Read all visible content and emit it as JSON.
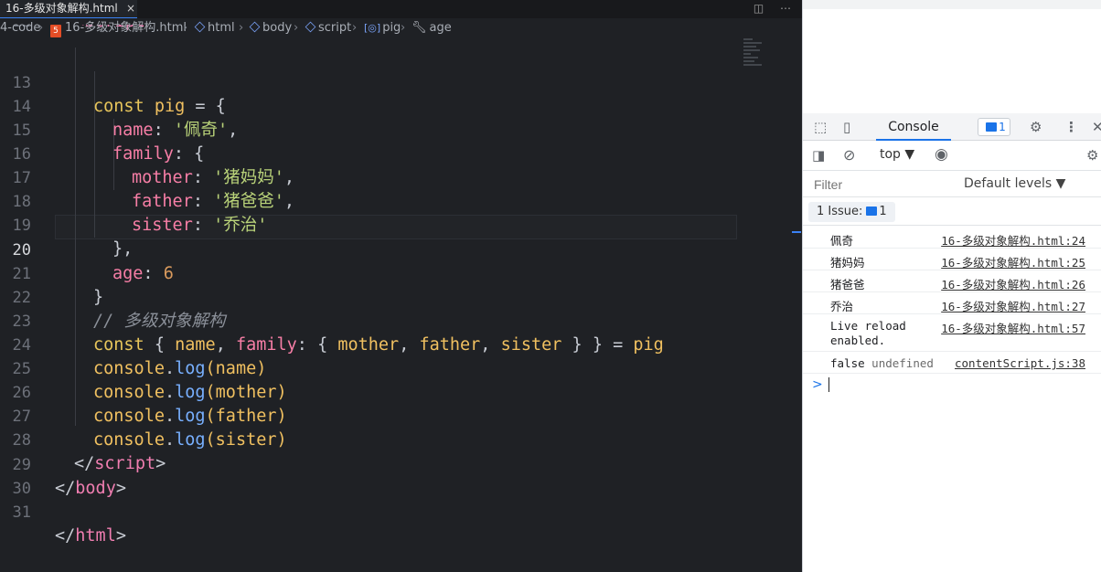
{
  "editor": {
    "tab_title": "16-多级对象解构.html",
    "tab_close": "×",
    "breadcrumb": {
      "folder": "4-code",
      "file": "16-多级对象解构.html",
      "html": "html",
      "body": "body",
      "script": "script",
      "pig": "pig",
      "age": "age"
    },
    "current_line": "20",
    "line_numbers": [
      "13",
      "14",
      "15",
      "16",
      "17",
      "18",
      "19",
      "20",
      "21",
      "22",
      "23",
      "24",
      "25",
      "26",
      "27",
      "28",
      "29",
      "30",
      "31"
    ],
    "code": {
      "l13_const": "const",
      "l13_var": "pig",
      "l13_rest": " = {",
      "l14_prop": "name",
      "l14_colon": ": ",
      "l14_str": "'佩奇'",
      "l14_comma": ",",
      "l15_prop": "family",
      "l15_rest": ": {",
      "l16_prop": "mother",
      "l16_colon": ": ",
      "l16_str": "'猪妈妈'",
      "l16_comma": ",",
      "l17_prop": "father",
      "l17_colon": ": ",
      "l17_str": "'猪爸爸'",
      "l17_comma": ",",
      "l18_prop": "sister",
      "l18_colon": ": ",
      "l18_str": "'乔治'",
      "l19": "},",
      "l20_prop": "age",
      "l20_colon": ": ",
      "l20_num": "6",
      "l21": "}",
      "l22": "// 多级对象解构",
      "l23_const": "const",
      "l23_a": " { ",
      "l23_name": "name",
      "l23_b": ", ",
      "l23_family": "family",
      "l23_c": ": { ",
      "l23_mother": "mother",
      "l23_d": ", ",
      "l23_father": "father",
      "l23_e": ", ",
      "l23_sister": "sister",
      "l23_f": " } } = ",
      "l23_pig": "pig",
      "console": "console",
      "dot": ".",
      "log": "log",
      "l24_arg": "(name)",
      "l25_arg": "(mother)",
      "l26_arg": "(father)",
      "l27_arg": "(sister)",
      "l28_open": "</",
      "l28_tag": "script",
      "l28_close": ">",
      "l29_open": "</",
      "l29_tag": "body",
      "l29_close": ">",
      "l31_open": "</",
      "l31_tag": "html",
      "l31_close": ">"
    }
  },
  "devtools": {
    "console_tab": "Console",
    "issue_count": "1",
    "context": "top ▼",
    "filter_placeholder": "Filter",
    "levels": "Default levels ▼",
    "issues_label": "1 Issue:",
    "issues_count": "1",
    "messages": [
      {
        "text": "佩奇",
        "source": "16-多级对象解构.html:24"
      },
      {
        "text": "猪妈妈",
        "source": "16-多级对象解构.html:25"
      },
      {
        "text": "猪爸爸",
        "source": "16-多级对象解构.html:26"
      },
      {
        "text": "乔治",
        "source": "16-多级对象解构.html:27"
      },
      {
        "text": "Live reload",
        "text2": "enabled.",
        "source": "16-多级对象解构.html:57"
      },
      {
        "text": "false",
        "text_und": "undefined",
        "source": "contentScript.js:38"
      }
    ],
    "prompt": ">"
  },
  "colors": {
    "editor_bg": "#1f2125",
    "keyword": "#f07eb1",
    "string": "#b9d279",
    "accent": "#1a73e8"
  },
  "icons": [
    "html5-icon",
    "cube-icon",
    "bracket-icon",
    "wrench-icon",
    "inspect-icon",
    "device-icon",
    "gear-icon",
    "more-icon",
    "close-icon",
    "sidebar-icon",
    "block-icon",
    "eye-icon"
  ]
}
